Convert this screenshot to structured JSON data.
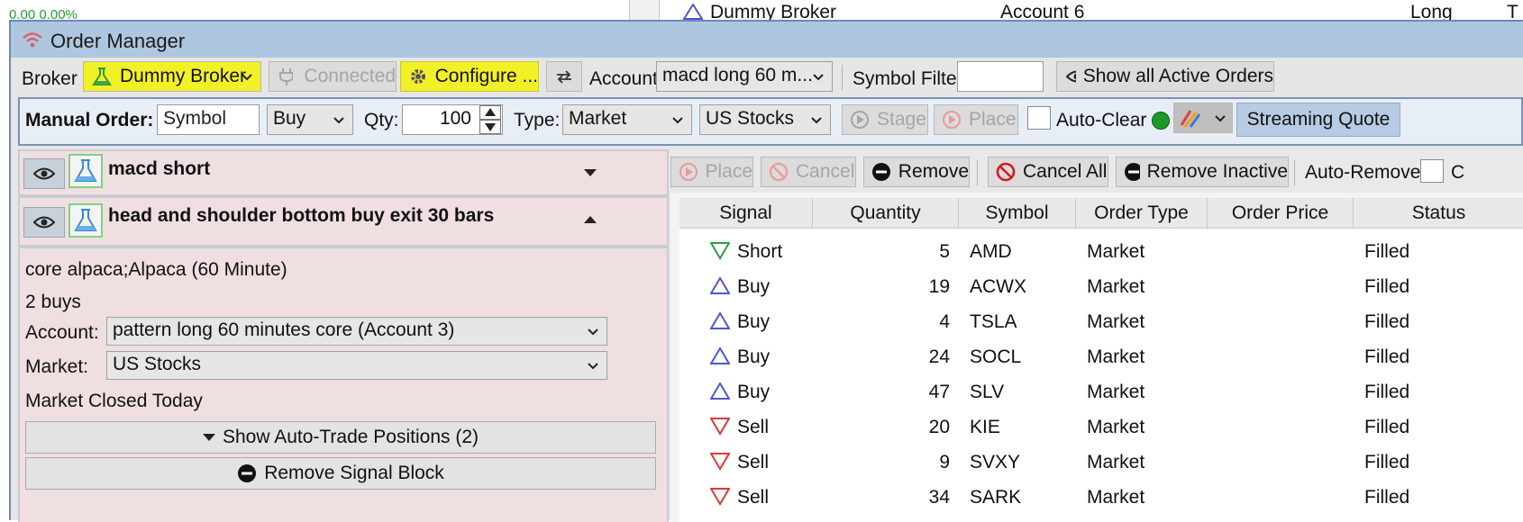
{
  "background": {
    "top_left_value": "0.00 0.00%",
    "top_row": {
      "signal": "Dummy Broker",
      "account": "Account 6",
      "side": "Long",
      "extra": "T"
    }
  },
  "window": {
    "title": "Order Manager",
    "accent_color": "#aec6e0",
    "highlight_color": "#f2f027"
  },
  "broker_bar": {
    "broker_label": "Broker",
    "broker_value": "Dummy Broker",
    "connected_label": "Connected",
    "configure_label": "Configure ...",
    "account_label": "Account",
    "account_value": "macd long 60 m...",
    "symbol_filter_label": "Symbol Filter",
    "symbol_filter_value": "",
    "show_all_label": "Show all Active Orders"
  },
  "manual_order": {
    "label": "Manual Order:",
    "symbol_placeholder": "Symbol",
    "side": "Buy",
    "qty_label": "Qty:",
    "qty": "100",
    "type_label": "Type:",
    "type": "Market",
    "market": "US Stocks",
    "stage_label": "Stage",
    "place_label": "Place",
    "auto_clear_label": "Auto-Clear",
    "streaming_label": "Streaming Quote"
  },
  "signal_blocks": [
    {
      "name": "macd short",
      "expanded": false
    },
    {
      "name": "head and shoulder bottom buy exit 30 bars",
      "expanded": true
    }
  ],
  "block_detail": {
    "source": "core alpaca;Alpaca (60 Minute)",
    "summary": "2 buys",
    "account_label": "Account:",
    "account_value": "pattern long 60 minutes core (Account 3)",
    "market_label": "Market:",
    "market_value": "US Stocks",
    "status": "Market Closed Today",
    "show_positions_label": "Show Auto-Trade Positions (2)",
    "remove_block_label": "Remove Signal Block"
  },
  "orders_toolbar": {
    "place_label": "Place",
    "cancel_label": "Cancel",
    "remove_label": "Remove",
    "cancel_all_label": "Cancel All",
    "remove_inactive_label": "Remove Inactive",
    "auto_remove_label": "Auto-Remove:",
    "auto_remove_trailing": "C"
  },
  "orders": {
    "columns": [
      "Signal",
      "Quantity",
      "Symbol",
      "Order Type",
      "Order Price",
      "Status"
    ],
    "rows": [
      {
        "signal": "Short",
        "dir": "short",
        "qty": "5",
        "symbol": "AMD",
        "type": "Market",
        "price": "",
        "status": "Filled"
      },
      {
        "signal": "Buy",
        "dir": "buy",
        "qty": "19",
        "symbol": "ACWX",
        "type": "Market",
        "price": "",
        "status": "Filled"
      },
      {
        "signal": "Buy",
        "dir": "buy",
        "qty": "4",
        "symbol": "TSLA",
        "type": "Market",
        "price": "",
        "status": "Filled"
      },
      {
        "signal": "Buy",
        "dir": "buy",
        "qty": "24",
        "symbol": "SOCL",
        "type": "Market",
        "price": "",
        "status": "Filled"
      },
      {
        "signal": "Buy",
        "dir": "buy",
        "qty": "47",
        "symbol": "SLV",
        "type": "Market",
        "price": "",
        "status": "Filled"
      },
      {
        "signal": "Sell",
        "dir": "sell",
        "qty": "20",
        "symbol": "KIE",
        "type": "Market",
        "price": "",
        "status": "Filled"
      },
      {
        "signal": "Sell",
        "dir": "sell",
        "qty": "9",
        "symbol": "SVXY",
        "type": "Market",
        "price": "",
        "status": "Filled"
      },
      {
        "signal": "Sell",
        "dir": "sell",
        "qty": "34",
        "symbol": "SARK",
        "type": "Market",
        "price": "",
        "status": "Filled"
      }
    ]
  }
}
